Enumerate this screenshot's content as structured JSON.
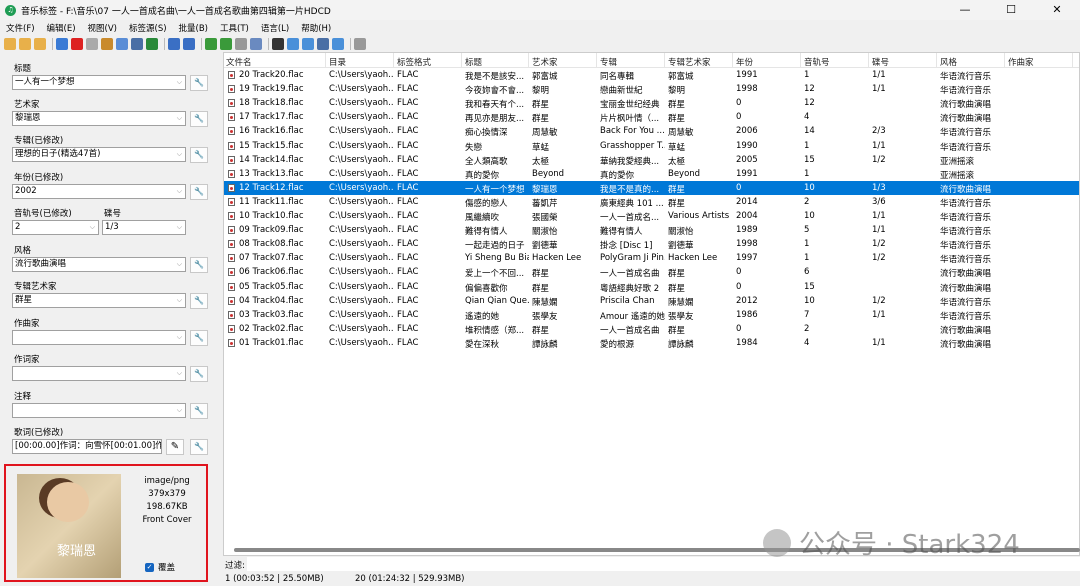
{
  "window": {
    "title": "音乐标签 - F:\\音乐\\07 一人一首成名曲\\一人一首成名歌曲第四辑第一片HDCD",
    "minimize": "—",
    "maximize": "☐",
    "close": "✕"
  },
  "menu": [
    "文件(F)",
    "编辑(E)",
    "视图(V)",
    "标签源(S)",
    "批量(B)",
    "工具(T)",
    "语言(L)",
    "帮助(H)"
  ],
  "toolbar": [
    "open-folder",
    "add-folder",
    "open-files",
    "save",
    "delete",
    "undo",
    "dictionary",
    "tool",
    "cover",
    "refresh",
    "columns",
    "columns2",
    "convert",
    "image",
    "text",
    "auto-tag",
    "batch",
    "rename",
    "export",
    "move",
    "network",
    "settings"
  ],
  "fields": [
    {
      "label": "标题",
      "value": "一人有一个梦想"
    },
    {
      "label": "艺术家",
      "value": "黎瑞恩"
    },
    {
      "label": "专辑(已修改)",
      "value": "理想的日子(精选47首)"
    },
    {
      "label": "年份(已修改)",
      "value": "2002"
    },
    {
      "label": "风格",
      "value": "流行歌曲演唱"
    },
    {
      "label": "专辑艺术家",
      "value": "群星"
    },
    {
      "label": "作曲家",
      "value": ""
    },
    {
      "label": "作词家",
      "value": ""
    },
    {
      "label": "注释",
      "value": ""
    }
  ],
  "track": {
    "label": "音轨号(已修改)",
    "value": "2"
  },
  "disc": {
    "label": "碟号",
    "value": "1/3"
  },
  "lyrics": {
    "label": "歌词(已修改)",
    "value": "[00:00.00]作词：向雪怀[00:01.00]作"
  },
  "cover": {
    "mime": "image/png",
    "dimensions": "379x379",
    "size": "198.67KB",
    "type": "Front Cover",
    "overwrite_label": "覆盖",
    "overwrite_checked": true,
    "art_text": "黎瑞恩"
  },
  "columns": [
    "文件名",
    "目录",
    "标签格式",
    "标题",
    "艺术家",
    "专辑",
    "专辑艺术家",
    "年份",
    "音轨号",
    "碟号",
    "风格",
    "作曲家"
  ],
  "rows": [
    [
      "20 Track20.flac",
      "C:\\Users\\yaoh...",
      "FLAC",
      "我是不是該安...",
      "郭富城",
      "同名專輯",
      "郭富城",
      "1991",
      "1",
      "1/1",
      "华语流行音乐",
      ""
    ],
    [
      "19 Track19.flac",
      "C:\\Users\\yaoh...",
      "FLAC",
      "今夜妳會不會...",
      "黎明",
      "戀曲新世紀",
      "黎明",
      "1998",
      "12",
      "1/1",
      "华语流行音乐",
      ""
    ],
    [
      "18 Track18.flac",
      "C:\\Users\\yaoh...",
      "FLAC",
      "我和春天有个...",
      "群星",
      "宝丽金世纪经典",
      "群星",
      "0",
      "12",
      "",
      "流行歌曲演唱",
      ""
    ],
    [
      "17 Track17.flac",
      "C:\\Users\\yaoh...",
      "FLAC",
      "再见亦是朋友...",
      "群星",
      "片片枫叶情（...",
      "群星",
      "0",
      "4",
      "",
      "流行歌曲演唱",
      ""
    ],
    [
      "16 Track16.flac",
      "C:\\Users\\yaoh...",
      "FLAC",
      "痴心換情深",
      "周慧敏",
      "Back For You ...",
      "周慧敏",
      "2006",
      "14",
      "2/3",
      "华语流行音乐",
      ""
    ],
    [
      "15 Track15.flac",
      "C:\\Users\\yaoh...",
      "FLAC",
      "失戀",
      "草蜢",
      "Grasshopper T...",
      "草蜢",
      "1990",
      "1",
      "1/1",
      "华语流行音乐",
      ""
    ],
    [
      "14 Track14.flac",
      "C:\\Users\\yaoh...",
      "FLAC",
      "全人類高歌",
      "太極",
      "華納我愛經典...",
      "太極",
      "2005",
      "15",
      "1/2",
      "亚洲摇滚",
      ""
    ],
    [
      "13 Track13.flac",
      "C:\\Users\\yaoh...",
      "FLAC",
      "真的愛你",
      "Beyond",
      "真的愛你",
      "Beyond",
      "1991",
      "1",
      "",
      "亚洲摇滚",
      ""
    ],
    [
      "12 Track12.flac",
      "C:\\Users\\yaoh...",
      "FLAC",
      "一人有一个梦想",
      "黎瑞恩",
      "我是不是真的...",
      "群星",
      "0",
      "10",
      "1/3",
      "流行歌曲演唱",
      ""
    ],
    [
      "11 Track11.flac",
      "C:\\Users\\yaoh...",
      "FLAC",
      "傷感的戀人",
      "蕃凱芹",
      "廣東經典 101 ...",
      "群星",
      "2014",
      "2",
      "3/6",
      "华语流行音乐",
      ""
    ],
    [
      "10 Track10.flac",
      "C:\\Users\\yaoh...",
      "FLAC",
      "風繼續吹",
      "張國榮",
      "一人一首成名...",
      "Various Artists",
      "2004",
      "10",
      "1/1",
      "华语流行音乐",
      ""
    ],
    [
      "09 Track09.flac",
      "C:\\Users\\yaoh...",
      "FLAC",
      "難得有情人",
      "關淑怡",
      "難得有情人",
      "關淑怡",
      "1989",
      "5",
      "1/1",
      "华语流行音乐",
      ""
    ],
    [
      "08 Track08.flac",
      "C:\\Users\\yaoh...",
      "FLAC",
      "一起走過的日子",
      "劉德華",
      "掛念 [Disc 1]",
      "劉德華",
      "1998",
      "1",
      "1/2",
      "华语流行音乐",
      ""
    ],
    [
      "07 Track07.flac",
      "C:\\Users\\yaoh...",
      "FLAC",
      "Yi Sheng Bu Bian",
      "Hacken Lee",
      "PolyGram Ji Pin...",
      "Hacken Lee",
      "1997",
      "1",
      "1/2",
      "华语流行音乐",
      ""
    ],
    [
      "06 Track06.flac",
      "C:\\Users\\yaoh...",
      "FLAC",
      "爱上一个不回...",
      "群星",
      "一人一首成名曲",
      "群星",
      "0",
      "6",
      "",
      "流行歌曲演唱",
      ""
    ],
    [
      "05 Track05.flac",
      "C:\\Users\\yaoh...",
      "FLAC",
      "偏偏喜歡你",
      "群星",
      "粵語經典好歌 2",
      "群星",
      "0",
      "15",
      "",
      "流行歌曲演唱",
      ""
    ],
    [
      "04 Track04.flac",
      "C:\\Users\\yaoh...",
      "FLAC",
      "Qian Qian Que...",
      "陳慧嫻",
      "Priscila Chan",
      "陳慧嫻",
      "2012",
      "10",
      "1/2",
      "华语流行音乐",
      ""
    ],
    [
      "03 Track03.flac",
      "C:\\Users\\yaoh...",
      "FLAC",
      "遙遠的她",
      "張學友",
      "Amour 遙遠的她",
      "張學友",
      "1986",
      "7",
      "1/1",
      "华语流行音乐",
      ""
    ],
    [
      "02 Track02.flac",
      "C:\\Users\\yaoh...",
      "FLAC",
      "堆积情感（郑...",
      "群星",
      "一人一首成名曲",
      "群星",
      "0",
      "2",
      "",
      "流行歌曲演唱",
      ""
    ],
    [
      "01 Track01.flac",
      "C:\\Users\\yaoh...",
      "FLAC",
      "愛在深秋",
      "譚詠麟",
      "愛的根源",
      "譚詠麟",
      "1984",
      "4",
      "1/1",
      "流行歌曲演唱",
      ""
    ]
  ],
  "selected_row": 8,
  "filter": {
    "label": "过滤:",
    "value": ""
  },
  "status": {
    "selected": "1 (00:03:52 | 25.50MB)",
    "total": "20 (01:24:32 | 529.93MB)"
  },
  "watermark": "公众号 · Stark324",
  "colors": {
    "selection": "#0078d7",
    "highlight_border": "#e0141e"
  }
}
